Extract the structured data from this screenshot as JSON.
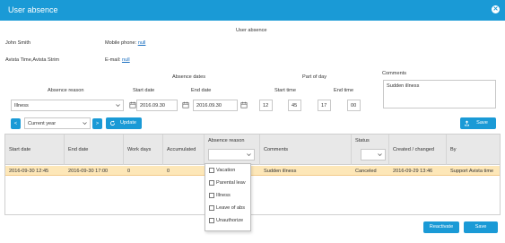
{
  "window": {
    "title": "User absence",
    "close_icon": "close-icon"
  },
  "section_title": "User absence",
  "user": {
    "name": "John Smith",
    "org": "Avista Time,Avista Strim",
    "mobile_label": "Mobile phone:",
    "mobile_value": "null",
    "email_label": "E-mail:",
    "email_value": "null"
  },
  "form": {
    "absence_dates_label": "Absence dates",
    "part_of_day_label": "Part of day",
    "comments_label": "Comments",
    "reason_label": "Absence reason",
    "start_date_label": "Start date",
    "end_date_label": "End date",
    "start_time_label": "Start time",
    "end_time_label": "End time",
    "reason_value": "Illness",
    "start_date_value": "2016.09.30",
    "end_date_value": "2016.09.30",
    "start_hour": "12",
    "start_min": "45",
    "end_hour": "17",
    "end_min": "00",
    "comments_value": "Sudden illness"
  },
  "toolbar": {
    "prev_label": "<",
    "period_value": "Current year",
    "next_label": ">",
    "update_label": "Update",
    "save_label": "Save"
  },
  "grid": {
    "headers": {
      "start_date": "Start date",
      "end_date": "End date",
      "work_days": "Work days",
      "accumulated": "Accumulated",
      "absence_reason": "Absence reason",
      "comments": "Comments",
      "status": "Status",
      "created": "Created / changed",
      "by": "By"
    },
    "row": {
      "start_date": "2016-09-30 12:45",
      "end_date": "2016-09-30 17:00",
      "work_days": "0",
      "accumulated": "0",
      "comments": "Sudden illness",
      "status": "Canceled",
      "created": "2016-09-29 13:46",
      "by": "Support Avista time"
    }
  },
  "reason_filter_options": [
    "Vacation",
    "Parental leav",
    "Illness",
    "Leave of abs",
    "Unauthorize"
  ],
  "footer": {
    "reactivate_label": "Reactivate",
    "save_label": "Save"
  },
  "colors": {
    "accent": "#1a9ad6",
    "selected_row": "#fde7b8",
    "header_bg": "#e8e8e8"
  }
}
